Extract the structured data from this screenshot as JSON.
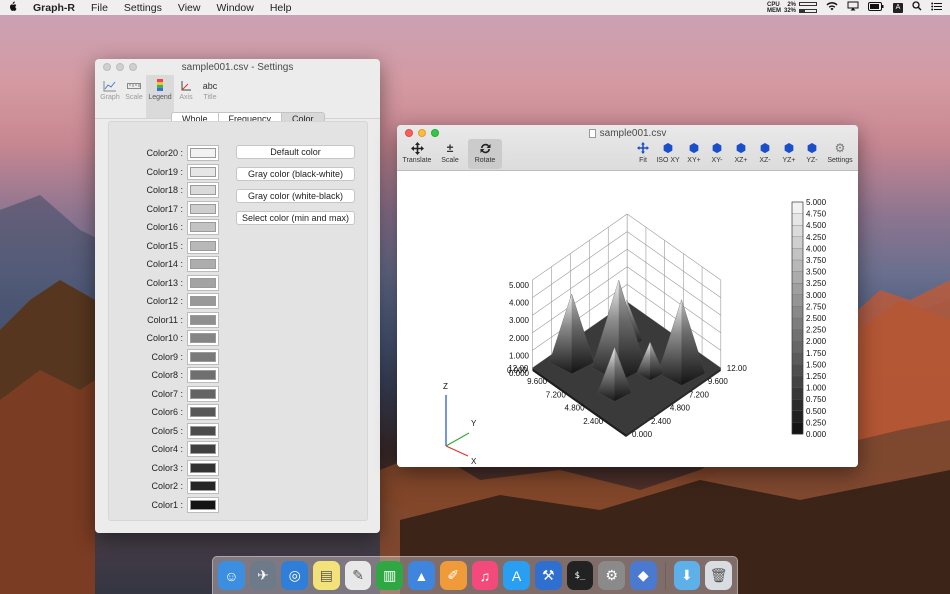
{
  "menubar": {
    "apple": "",
    "app_name": "Graph-R",
    "menus": [
      "File",
      "Settings",
      "View",
      "Window",
      "Help"
    ],
    "status": {
      "cpu_label": "CPU",
      "cpu_pct": "2%",
      "mem_label": "MEM",
      "mem_pct": "32%",
      "input_source": "A"
    }
  },
  "settings_window": {
    "title": "sample001.csv - Settings",
    "toolbar": [
      {
        "label": "Graph",
        "icon": "line-chart-icon"
      },
      {
        "label": "Scale",
        "icon": "ruler-icon"
      },
      {
        "label": "Legend",
        "icon": "legend-icon",
        "selected": true
      },
      {
        "label": "Axis",
        "icon": "axis-icon"
      },
      {
        "label": "Title",
        "icon": "abc-text-icon",
        "glyph": "abc"
      }
    ],
    "tabs": [
      "Whole",
      "Frequency",
      "Color"
    ],
    "selected_tab": "Color",
    "colors": [
      {
        "label": "Color20 :",
        "hex": "#f2f2f2"
      },
      {
        "label": "Color19 :",
        "hex": "#e6e6e6"
      },
      {
        "label": "Color18 :",
        "hex": "#dadada"
      },
      {
        "label": "Color17 :",
        "hex": "#cecece"
      },
      {
        "label": "Color16 :",
        "hex": "#c3c3c3"
      },
      {
        "label": "Color15 :",
        "hex": "#b8b8b8"
      },
      {
        "label": "Color14 :",
        "hex": "#adadad"
      },
      {
        "label": "Color13 :",
        "hex": "#a3a3a3"
      },
      {
        "label": "Color12 :",
        "hex": "#999999"
      },
      {
        "label": "Color11 :",
        "hex": "#8f8f8f"
      },
      {
        "label": "Color10 :",
        "hex": "#858585"
      },
      {
        "label": "Color9 :",
        "hex": "#7a7a7a"
      },
      {
        "label": "Color8 :",
        "hex": "#6f6f6f"
      },
      {
        "label": "Color7 :",
        "hex": "#646464"
      },
      {
        "label": "Color6 :",
        "hex": "#585858"
      },
      {
        "label": "Color5 :",
        "hex": "#4c4c4c"
      },
      {
        "label": "Color4 :",
        "hex": "#404040"
      },
      {
        "label": "Color3 :",
        "hex": "#333333"
      },
      {
        "label": "Color2 :",
        "hex": "#262626"
      },
      {
        "label": "Color1 :",
        "hex": "#141414"
      }
    ],
    "buttons": [
      "Default color",
      "Gray color (black-white)",
      "Gray color (white-black)",
      "Select color (min and max)"
    ]
  },
  "plot_window": {
    "title": "sample001.csv",
    "tools_left": [
      {
        "label": "Translate",
        "icon": "move-arrows-icon"
      },
      {
        "label": "Scale",
        "icon": "plus-minus-icon"
      },
      {
        "label": "Rotate",
        "icon": "rotate-icon",
        "selected": true
      }
    ],
    "tools_right": [
      {
        "label": "Fit",
        "icon": "fit-arrows-icon"
      },
      {
        "label": "ISO XY",
        "icon": "cube-icon"
      },
      {
        "label": "XY+",
        "icon": "cube-icon"
      },
      {
        "label": "XY-",
        "icon": "cube-icon"
      },
      {
        "label": "XZ+",
        "icon": "cube-icon"
      },
      {
        "label": "XZ-",
        "icon": "cube-icon"
      },
      {
        "label": "YZ+",
        "icon": "cube-icon"
      },
      {
        "label": "YZ-",
        "icon": "cube-icon"
      },
      {
        "label": "Settings",
        "icon": "gear-icon"
      }
    ],
    "z_axis_ticks": [
      "0.000",
      "1.000",
      "2.000",
      "3.000",
      "4.000",
      "5.000"
    ],
    "x_axis_ticks": [
      "0.000",
      "2.400",
      "4.800",
      "7.200",
      "9.600",
      "12.00"
    ],
    "y_axis_ticks": [
      "0.000",
      "2.400",
      "4.800",
      "7.200",
      "9.600",
      "12.00"
    ],
    "colorbar_labels": [
      "5.000",
      "4.750",
      "4.500",
      "4.250",
      "4.000",
      "3.750",
      "3.500",
      "3.250",
      "3.000",
      "2.750",
      "2.500",
      "2.250",
      "2.000",
      "1.750",
      "1.500",
      "1.250",
      "1.000",
      "0.750",
      "0.500",
      "0.250",
      "0.000"
    ],
    "orientation": {
      "z": "Z",
      "y": "Y",
      "x": "X"
    }
  },
  "chart_data": {
    "type": "surface",
    "xlabel": "",
    "ylabel": "",
    "zlabel": "",
    "xlim": [
      0,
      12
    ],
    "ylim": [
      0,
      12
    ],
    "zlim": [
      0,
      5
    ],
    "colormap": "gray (black-white)",
    "peaks": [
      {
        "x": 6.5,
        "y": 5.5,
        "z": 5.0
      },
      {
        "x": 2.0,
        "y": 9.0,
        "z": 4.2
      },
      {
        "x": 10.0,
        "y": 3.0,
        "z": 3.9
      },
      {
        "x": 4.5,
        "y": 3.0,
        "z": 2.6
      },
      {
        "x": 8.5,
        "y": 8.5,
        "z": 2.3
      },
      {
        "x": 4.0,
        "y": 7.0,
        "z": 1.8
      }
    ]
  },
  "dock": {
    "apps": [
      {
        "name": "finder-icon",
        "color": "#3c8fe0"
      },
      {
        "name": "launchpad-icon",
        "color": "#6c7a8a"
      },
      {
        "name": "safari-icon",
        "color": "#2f7fd8"
      },
      {
        "name": "notes-icon",
        "color": "#f3e27a"
      },
      {
        "name": "textedit-icon",
        "color": "#e8e8e8"
      },
      {
        "name": "numbers-icon",
        "color": "#2fa844"
      },
      {
        "name": "keynote-icon",
        "color": "#3f85dd"
      },
      {
        "name": "pages-icon",
        "color": "#f09b3a"
      },
      {
        "name": "itunes-icon",
        "color": "#f24a7a"
      },
      {
        "name": "app-store-icon",
        "color": "#2a9ef0"
      },
      {
        "name": "xcode-icon",
        "color": "#2f6fcf"
      },
      {
        "name": "terminal-icon",
        "color": "#222222"
      },
      {
        "name": "system-preferences-icon",
        "color": "#8a8a8a"
      },
      {
        "name": "graph-r-icon",
        "color": "#4a7ad0"
      },
      {
        "name": "downloads-folder-icon",
        "color": "#5eb0e8"
      },
      {
        "name": "trash-icon",
        "color": "#d9dde2"
      }
    ]
  }
}
